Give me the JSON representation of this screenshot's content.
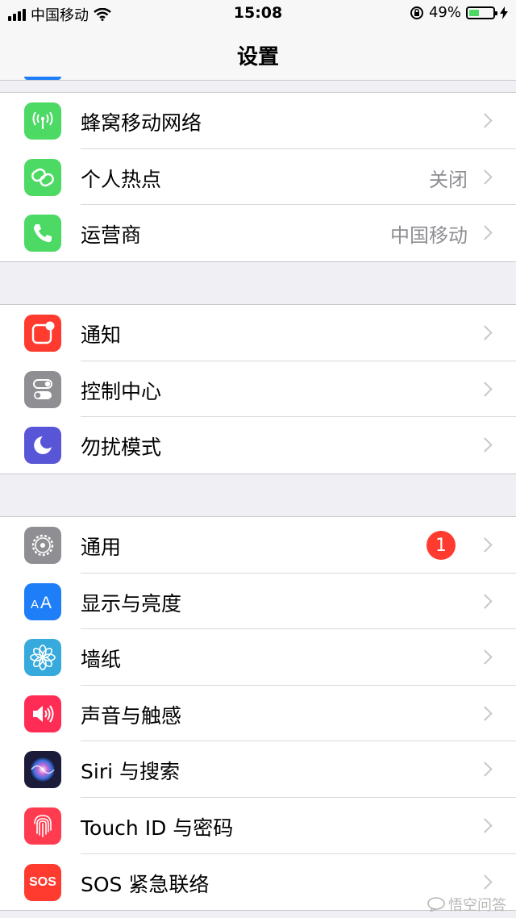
{
  "status_bar": {
    "carrier": "中国移动",
    "time": "15:08",
    "battery_percent_label": "49%",
    "battery_level": 0.49
  },
  "nav": {
    "title": "设置"
  },
  "group1": [
    {
      "label": "蜂窝移动网络",
      "value": "",
      "icon": "antenna-icon",
      "color": "#4cd964"
    },
    {
      "label": "个人热点",
      "value": "关闭",
      "icon": "hotspot-link-icon",
      "color": "#4cd964"
    },
    {
      "label": "运营商",
      "value": "中国移动",
      "icon": "phone-icon",
      "color": "#4cd964"
    }
  ],
  "group2": [
    {
      "label": "通知",
      "value": "",
      "icon": "notifications-icon",
      "color": "#ff3b30"
    },
    {
      "label": "控制中心",
      "value": "",
      "icon": "toggles-icon",
      "color": "#8e8e93"
    },
    {
      "label": "勿扰模式",
      "value": "",
      "icon": "moon-icon",
      "color": "#5856d6"
    }
  ],
  "group3": [
    {
      "label": "通用",
      "value": "",
      "badge": "1",
      "icon": "gear-icon",
      "color": "#8e8e93"
    },
    {
      "label": "显示与亮度",
      "value": "",
      "icon": "text-size-icon",
      "color": "#1e7ef8"
    },
    {
      "label": "墙纸",
      "value": "",
      "icon": "flower-icon",
      "color": "#36aadc"
    },
    {
      "label": "声音与触感",
      "value": "",
      "icon": "speaker-icon",
      "color": "#ff2d55"
    },
    {
      "label": "Siri 与搜索",
      "value": "",
      "icon": "siri-icon",
      "color": "#1c1c3a"
    },
    {
      "label": "Touch ID 与密码",
      "value": "",
      "icon": "fingerprint-icon",
      "color": "#ff3b50"
    },
    {
      "label": "SOS 紧急联络",
      "value": "",
      "icon": "sos-icon",
      "color": "#ff3b30",
      "icon_text": "SOS"
    }
  ],
  "watermark": "悟空问答"
}
